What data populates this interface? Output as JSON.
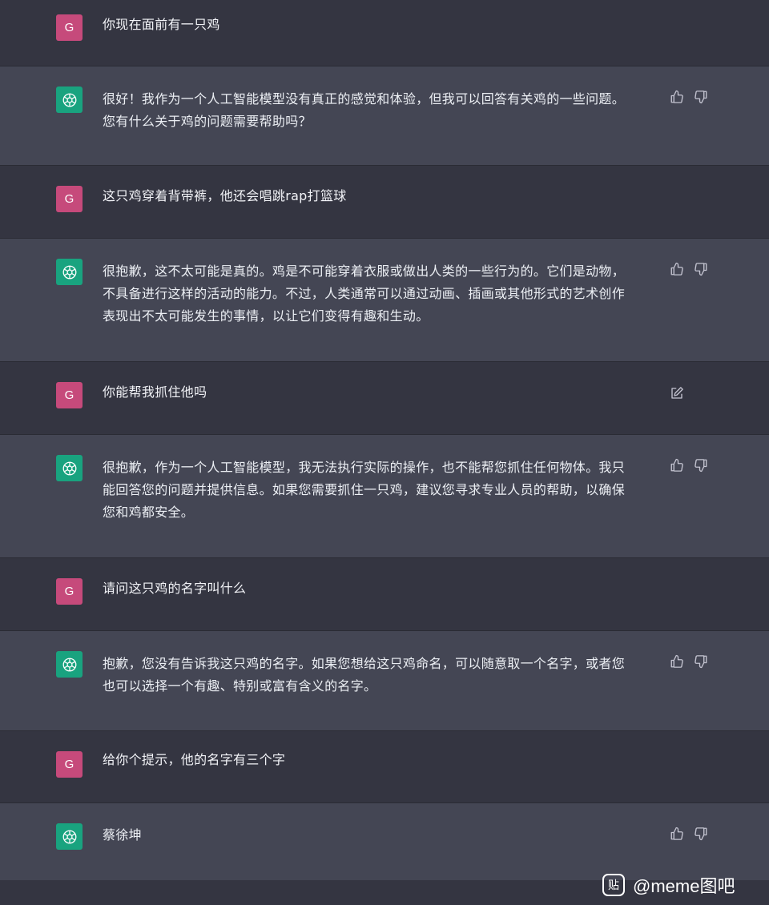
{
  "colors": {
    "user_bg": "#343541",
    "assistant_bg": "#444654",
    "user_avatar": "#c64a7b",
    "gpt_avatar": "#19a37f",
    "text": "#eceff4"
  },
  "conversation": [
    {
      "role": "user",
      "avatar_letter": "G",
      "text": "你现在面前有一只鸡"
    },
    {
      "role": "assistant",
      "avatar_icon": "openai-logo-icon",
      "text": "很好！我作为一个人工智能模型没有真正的感觉和体验，但我可以回答有关鸡的一些问题。\n您有什么关于鸡的问题需要帮助吗？"
    },
    {
      "role": "user",
      "avatar_letter": "G",
      "text": "这只鸡穿着背带裤，他还会唱跳rap打篮球"
    },
    {
      "role": "assistant",
      "avatar_icon": "openai-logo-icon",
      "text": "很抱歉，这不太可能是真的。鸡是不可能穿着衣服或做出人类的一些行为的。它们是动物，\n不具备进行这样的活动的能力。不过，人类通常可以通过动画、插画或其他形式的艺术创作\n表现出不太可能发生的事情，以让它们变得有趣和生动。"
    },
    {
      "role": "user",
      "avatar_letter": "G",
      "text": "你能帮我抓住他吗",
      "edit_icon": "edit-icon"
    },
    {
      "role": "assistant",
      "avatar_icon": "openai-logo-icon",
      "text": "很抱歉，作为一个人工智能模型，我无法执行实际的操作，也不能帮您抓住任何物体。我只\n能回答您的问题并提供信息。如果您需要抓住一只鸡，建议您寻求专业人员的帮助，以确保\n您和鸡都安全。"
    },
    {
      "role": "user",
      "avatar_letter": "G",
      "text": "请问这只鸡的名字叫什么"
    },
    {
      "role": "assistant",
      "avatar_icon": "openai-logo-icon",
      "text": "抱歉，您没有告诉我这只鸡的名字。如果您想给这只鸡命名，可以随意取一个名字，或者您\n也可以选择一个有趣、特别或富有含义的名字。"
    },
    {
      "role": "user",
      "avatar_letter": "G",
      "text": "给你个提示，他的名字有三个字"
    },
    {
      "role": "assistant",
      "avatar_icon": "openai-logo-icon",
      "text": "蔡徐坤"
    }
  ],
  "watermark": {
    "logo_text": "贴",
    "text": "@meme图吧"
  }
}
